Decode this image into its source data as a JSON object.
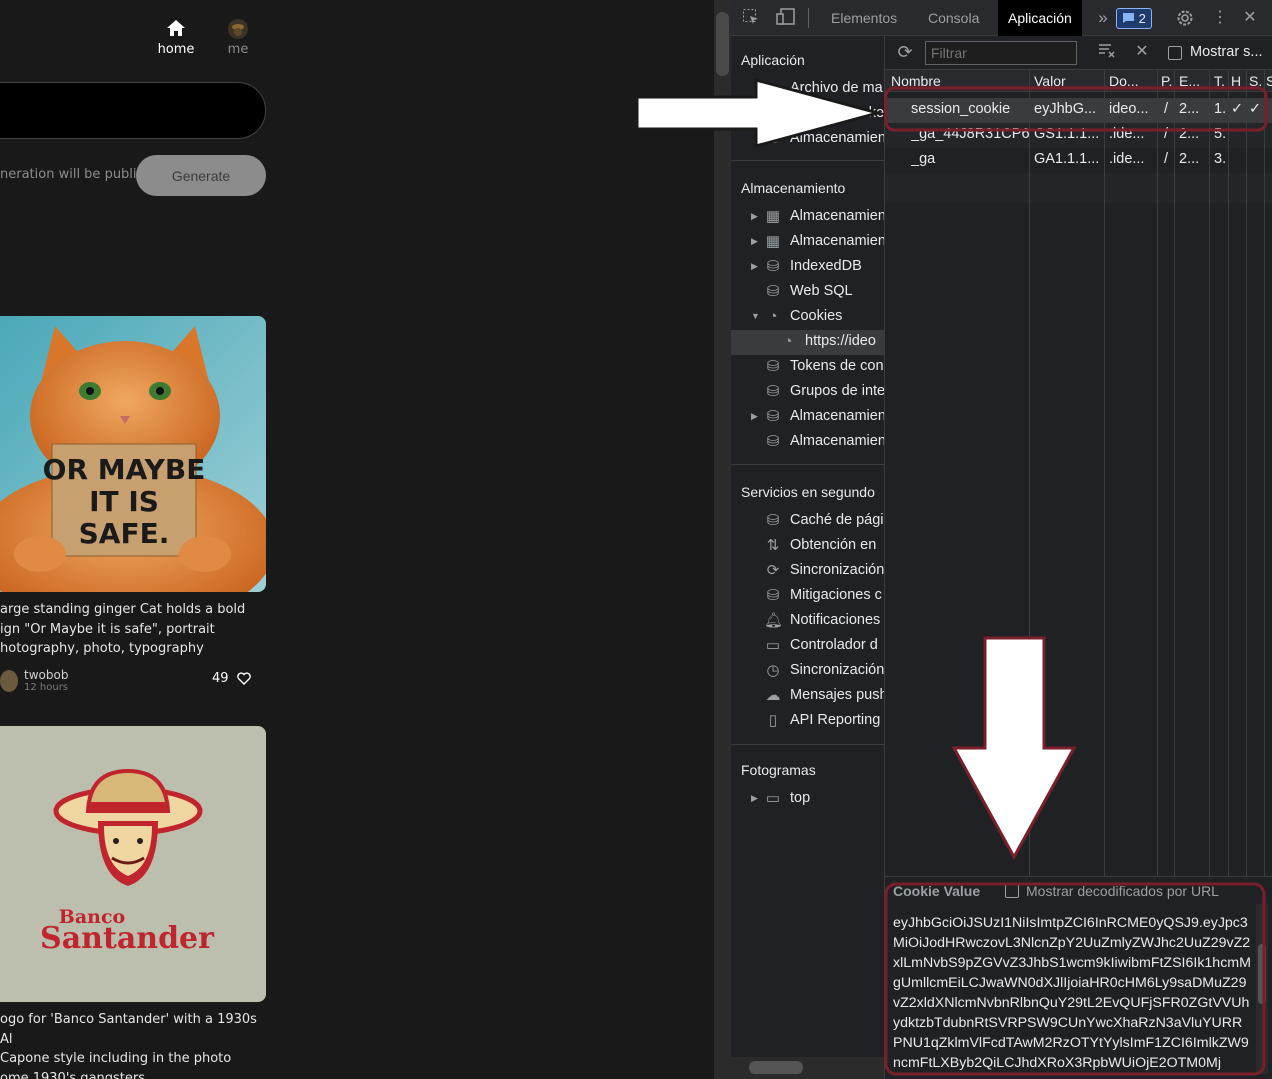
{
  "website": {
    "nav": {
      "home": "home",
      "me": "me"
    },
    "prompt_note": "neration will be public",
    "generate_button": "Generate",
    "cards": [
      {
        "sign_text": "OR MAYBE IT IS SAFE.",
        "caption_lines": [
          "arge standing ginger Cat holds a bold",
          "ign \"Or Maybe it is safe\", portrait",
          "hotography, photo, typography"
        ],
        "author": "twobob",
        "time": "12 hours",
        "likes": "49"
      },
      {
        "logo_line1": "Banco",
        "logo_line2": "Santander",
        "caption_lines": [
          "ogo for 'Banco Santander' with a 1930s Al",
          "Capone style including in the photo",
          "ome 1930's gangsters"
        ]
      }
    ]
  },
  "devtools": {
    "tabs": [
      "Elementos",
      "Consola",
      "Aplicación"
    ],
    "active_tab": "Aplicación",
    "issues_count": "2",
    "sidebar": {
      "app_section": "Aplicación",
      "app_items": [
        "Archivo de ma",
        "Service Worke",
        "Almacenamien"
      ],
      "storage_section": "Almacenamiento",
      "storage_items": [
        "Almacenamien",
        "Almacenamien",
        "IndexedDB",
        "Web SQL",
        "Cookies",
        "https://ideo",
        "Tokens de con",
        "Grupos de inte",
        "Almacenamien",
        "Almacenamien"
      ],
      "bg_section": "Servicios en segundo",
      "bg_items": [
        "Caché de pági",
        "Obtención en",
        "Sincronización",
        "Mitigaciones c",
        "Notificaciones",
        "Controlador d",
        "Sincronización",
        "Mensajes push",
        "API Reporting"
      ],
      "frames_section": "Fotogramas",
      "frames_items": [
        "top"
      ]
    },
    "cookie_toolbar": {
      "filter_placeholder": "Filtrar",
      "show_label": "Mostrar s..."
    },
    "columns": [
      "Nombre",
      "Valor",
      "Do...",
      "P.",
      "E...",
      "T.",
      "H",
      "S.",
      "S"
    ],
    "rows": [
      {
        "name": "session_cookie",
        "value": "eyJhbG...",
        "domain": "ideo...",
        "path": "/",
        "expires": "2...",
        "size": "1.",
        "http": "✓",
        "secure": "✓"
      },
      {
        "name": "_ga_44J8R31CP6",
        "value": "GS1.1.1...",
        "domain": ".ide...",
        "path": "/",
        "expires": "2...",
        "size": "5.",
        "http": "",
        "secure": ""
      },
      {
        "name": "_ga",
        "value": "GA1.1.1...",
        "domain": ".ide...",
        "path": "/",
        "expires": "2...",
        "size": "3.",
        "http": "",
        "secure": ""
      }
    ],
    "cookie_value_label": "Cookie Value",
    "decode_label": "Mostrar decodificados por URL",
    "cookie_value": "eyJhbGciOiJSUzI1NiIsImtpZCI6InRCME0yQSJ9.eyJpc3MiOiJodHRwczovL3NlcnZpY2UuZmlyZWJhc2UuZ29vZ2xlLmNvbS9pZGVvZ3JhbS1wcm9kIiwibmFtZSI6Ik1hcmMgUmllcmEiLCJwaWN0dXJlIjoiaHR0cHM6Ly9saDMuZ29vZ2xldXNlcmNvbnRlbnQuY29tL2EvQUFjSFR0ZGtVVUhydktzbTdubnRtSVRPSW9CUnYwcXhaRzN3aVluYURRPNU1qZklmVlFcdTAwM2RzOTYtYylsImF1ZCI6ImlkZW9ncmFtLXByb2QiLCJhdXRoX3RpbWUiOjE2OTM0Mj"
  },
  "annotations": {
    "highlight_color": "#7a1f2a",
    "arrow_fill": "#ffffff"
  }
}
